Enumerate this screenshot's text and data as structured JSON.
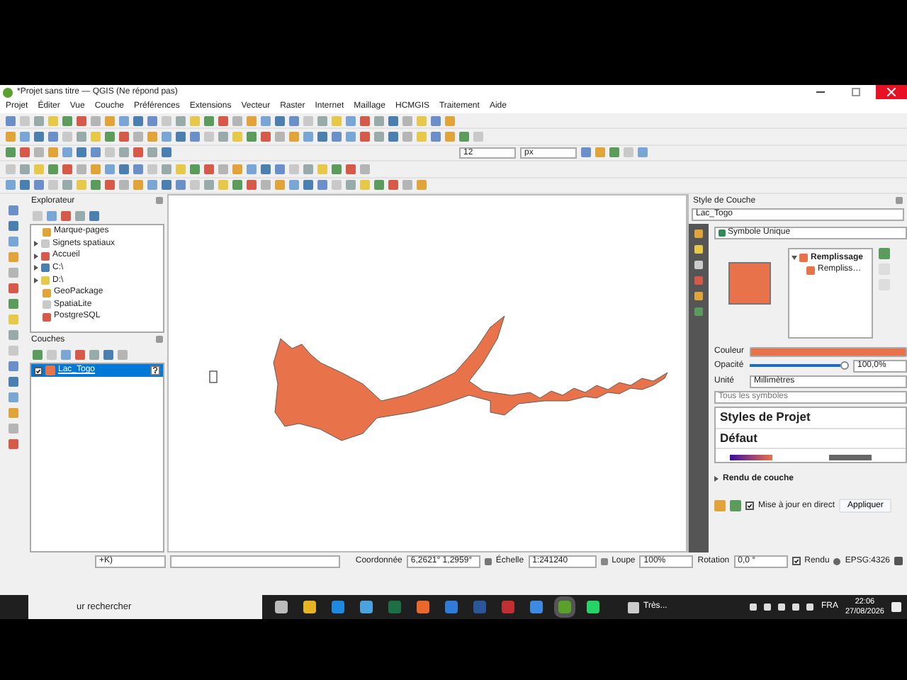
{
  "window": {
    "title": "*Projet sans titre — QGIS (Ne répond pas)"
  },
  "menu": [
    "Projet",
    "Éditer",
    "Vue",
    "Couche",
    "Préférences",
    "Extensions",
    "Vecteur",
    "Raster",
    "Internet",
    "Maillage",
    "HCMGIS",
    "Traitement",
    "Aide"
  ],
  "toolbar": {
    "size_value": "12",
    "size_unit": "px"
  },
  "browser": {
    "title": "Explorateur",
    "items": [
      {
        "label": "Marque-pages",
        "has_children": false
      },
      {
        "label": "Signets spatiaux",
        "has_children": true
      },
      {
        "label": "Accueil",
        "has_children": true
      },
      {
        "label": "C:\\",
        "has_children": true
      },
      {
        "label": "D:\\",
        "has_children": true
      },
      {
        "label": "GeoPackage",
        "has_children": false
      },
      {
        "label": "SpatiaLite",
        "has_children": false
      },
      {
        "label": "PostgreSQL",
        "has_children": false
      }
    ]
  },
  "layers": {
    "title": "Couches",
    "items": [
      {
        "name": "Lac_Togo",
        "checked": true,
        "selected": true,
        "color": "#e8734a"
      }
    ]
  },
  "style_panel": {
    "title": "Style de Couche",
    "layer": "Lac_Togo",
    "renderer": "Symbole Unique",
    "symbol_tree": [
      {
        "label": "Remplissage",
        "children": [
          {
            "label": "Rempliss…"
          }
        ]
      }
    ],
    "color_label": "Couleur",
    "opacity_label": "Opacité",
    "opacity": {
      "level": 1.0
    },
    "opacity_value": "100,0%",
    "unit_label": "Unité",
    "unit": "Millimètres",
    "search_placeholder": "Tous les symboles",
    "styles": [
      "Styles de Projet",
      "Défaut"
    ],
    "rendering": "Rendu de couche",
    "live_update": {
      "label": "Mise à jour en direct",
      "checked": true
    },
    "apply": "Appliquer"
  },
  "status_bar": {
    "locator": "+K)",
    "coord_label": "Coordonnée",
    "coord": "6,2621° 1,2959°",
    "scale_label": "Échelle",
    "scale": "1:241240",
    "zoom_label": "Loupe",
    "zoom": "100%",
    "rotation_label": "Rotation",
    "rotation": "0,0 °",
    "render": {
      "label": "Rendu",
      "checked": true
    },
    "crs": "EPSG:4326"
  },
  "taskbar": {
    "search": "ur rechercher",
    "app_label": "Très...",
    "lang": "FRA",
    "time": "22:06",
    "date": "27/08/2026"
  }
}
